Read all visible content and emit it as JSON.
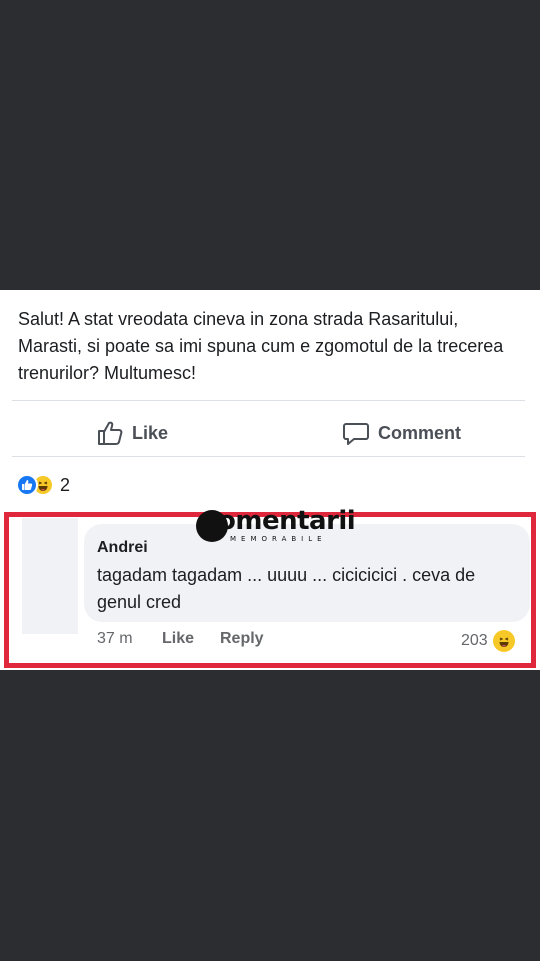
{
  "post": {
    "text": "Salut! A stat vreodata cineva in zona strada Rasaritului, Marasti, si poate sa imi spuna cum e zgomotul de la trecerea trenurilor? Multumesc!"
  },
  "actions": {
    "like_label": "Like",
    "comment_label": "Comment"
  },
  "reactions": {
    "count": "2",
    "icons": [
      "like-icon",
      "haha-icon"
    ]
  },
  "comment": {
    "author": "Andrei",
    "text": "tagadam tagadam ... uuuu ... cicicicici . ceva de genul cred",
    "time": "37 m",
    "like_label": "Like",
    "reply_label": "Reply",
    "reaction_count": "203",
    "reaction_icon": "haha-icon"
  },
  "watermark": {
    "word": "omentarii",
    "subtitle": "MEMORABILE"
  },
  "colors": {
    "highlight_border": "#e0283d",
    "like_blue": "#1877f2",
    "haha_yellow": "#f7c928",
    "background": "#2c2d31"
  }
}
